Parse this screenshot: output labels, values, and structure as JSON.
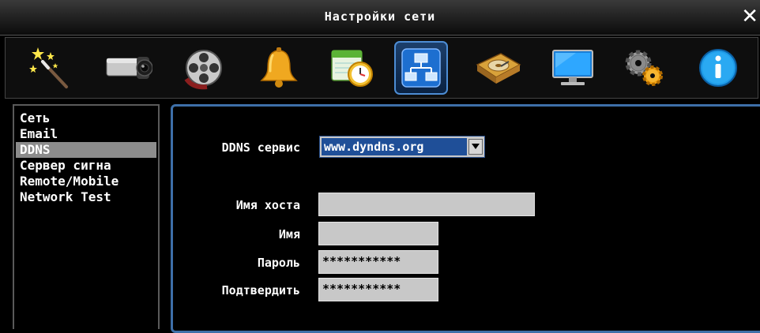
{
  "window": {
    "title": "Настройки сети",
    "close_glyph": "✕"
  },
  "toolbar": {
    "items": [
      {
        "icon": "wizard-wand-icon"
      },
      {
        "icon": "camera-icon"
      },
      {
        "icon": "film-reel-icon"
      },
      {
        "icon": "alarm-bell-icon"
      },
      {
        "icon": "schedule-clock-icon"
      },
      {
        "icon": "network-icon",
        "active": true
      },
      {
        "icon": "hard-disk-icon"
      },
      {
        "icon": "display-monitor-icon"
      },
      {
        "icon": "gears-icon"
      },
      {
        "icon": "info-icon"
      }
    ]
  },
  "sidebar": {
    "items": [
      {
        "label": "Сеть"
      },
      {
        "label": "Email"
      },
      {
        "label": "DDNS",
        "selected": true
      },
      {
        "label": "Сервер сигна"
      },
      {
        "label": "Remote/Mobile"
      },
      {
        "label": "Network Test"
      }
    ]
  },
  "form": {
    "ddns_service": {
      "label": "DDNS сервис",
      "value": "www.dyndns.org"
    },
    "hostname": {
      "label": "Имя хоста",
      "value": ""
    },
    "username": {
      "label": "Имя",
      "value": ""
    },
    "password": {
      "label": "Пароль",
      "value": "***********"
    },
    "confirm": {
      "label": "Подтвердить",
      "value": "***********"
    }
  },
  "colors": {
    "accent_border": "#3d6fa8",
    "selection": "#1f4f98",
    "menu_selected": "#8c8c8c",
    "field_bg": "#c8c8c8"
  }
}
